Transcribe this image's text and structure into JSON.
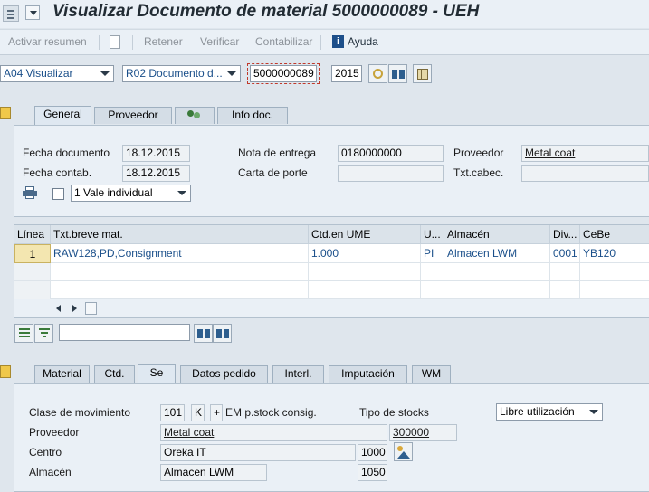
{
  "title": "Visualizar Documento de material 5000000089 - UEH",
  "toolbar": {
    "activar_resumen": "Activar resumen",
    "retener": "Retener",
    "verificar": "Verificar",
    "contabilizar": "Contabilizar",
    "ayuda": "Ayuda"
  },
  "header": {
    "action_select": "A04 Visualizar",
    "doc_type_select": "R02 Documento d...",
    "document_number": "5000000089",
    "year": "2015"
  },
  "top_tabs": [
    {
      "label": "General",
      "active": true
    },
    {
      "label": "Proveedor"
    },
    {
      "label": ""
    },
    {
      "label": "Info doc."
    }
  ],
  "general": {
    "fecha_documento_label": "Fecha documento",
    "fecha_documento": "18.12.2015",
    "fecha_contab_label": "Fecha contab.",
    "fecha_contab": "18.12.2015",
    "nota_entrega_label": "Nota de entrega",
    "nota_entrega": "0180000000",
    "carta_porte_label": "Carta de porte",
    "carta_porte": "",
    "proveedor_label": "Proveedor",
    "proveedor": "Metal coat",
    "txt_cabec_label": "Txt.cabec.",
    "txt_cabec": "",
    "vale_select": "1 Vale individual"
  },
  "table": {
    "headers": [
      "Línea",
      "Txt.breve mat.",
      "Ctd.en UME",
      "U...",
      "Almacén",
      "Div...",
      "CeBe"
    ],
    "rows": [
      [
        "1",
        "RAW128,PD,Consignment",
        "1.000",
        "PI",
        "Almacen LWM",
        "0001",
        "YB120"
      ]
    ]
  },
  "bottom_tabs": [
    {
      "label": "Material"
    },
    {
      "label": "Ctd."
    },
    {
      "label": "Se",
      "active": true
    },
    {
      "label": "Datos pedido"
    },
    {
      "label": "Interl."
    },
    {
      "label": "Imputación"
    },
    {
      "label": "WM"
    }
  ],
  "detail": {
    "clase_mov_label": "Clase de movimiento",
    "clase_mov": "101",
    "clase_mov_k": "K",
    "clase_mov_plus": "+",
    "clase_mov_text": "EM p.stock consig.",
    "tipo_stocks_label": "Tipo de stocks",
    "tipo_stocks": "Libre utilización",
    "proveedor_label": "Proveedor",
    "proveedor": "Metal coat",
    "proveedor_num": "300000",
    "centro_label": "Centro",
    "centro": "Oreka IT",
    "centro_num": "1000",
    "almacen_label": "Almacén",
    "almacen": "Almacen LWM",
    "almacen_num": "1050"
  },
  "colors": {
    "background": "#dfe6ed",
    "panel": "#eaf0f6",
    "link_blue": "#1a4f8a",
    "title": "#222c34"
  }
}
